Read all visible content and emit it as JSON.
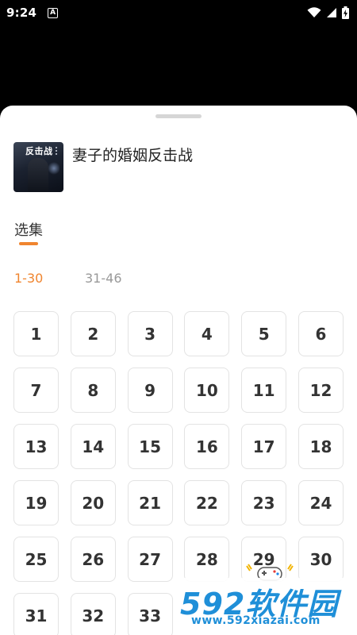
{
  "status_bar": {
    "time": "9:24",
    "notification_icon": "a-notification-icon",
    "wifi_icon": "wifi-icon",
    "signal_icon": "signal-icon",
    "battery_icon": "battery-charging-icon"
  },
  "sheet": {
    "drama_title": "妻子的婚姻反击战",
    "poster_text": "反击战",
    "section_label": "选集",
    "range_tabs": [
      {
        "label": "1-30",
        "active": true
      },
      {
        "label": "31-46",
        "active": false
      }
    ],
    "episodes": [
      "1",
      "2",
      "3",
      "4",
      "5",
      "6",
      "7",
      "8",
      "9",
      "10",
      "11",
      "12",
      "13",
      "14",
      "15",
      "16",
      "17",
      "18",
      "19",
      "20",
      "21",
      "22",
      "23",
      "24",
      "25",
      "26",
      "27",
      "28",
      "29",
      "30",
      "31",
      "32",
      "33"
    ]
  },
  "watermark": {
    "logo": "592软件园",
    "url": "www.592xiazai.com"
  },
  "colors": {
    "accent": "#f0852f",
    "watermark": "#1f8fd8"
  }
}
